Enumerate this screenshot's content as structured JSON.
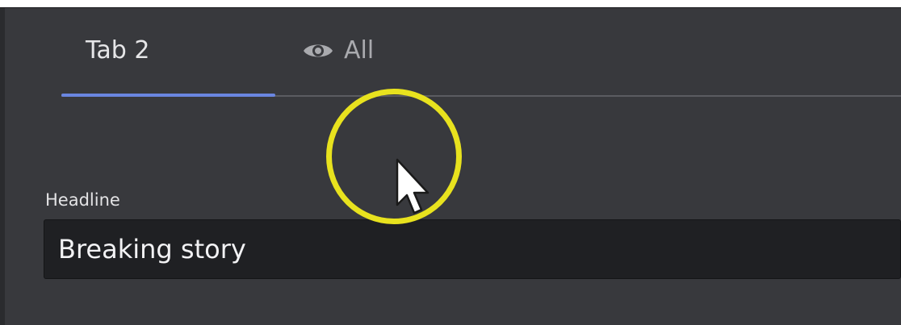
{
  "tabs": [
    {
      "label": "Tab 2",
      "active": true
    },
    {
      "label": "All",
      "icon": "eye-icon",
      "active": false
    }
  ],
  "form": {
    "headline_label": "Headline",
    "headline_value": "Breaking story"
  },
  "colors": {
    "panel_bg": "#38393d",
    "input_bg": "#1f2023",
    "active_tab_accent": "#6a86e0",
    "highlight_ring": "#e8e21e"
  }
}
